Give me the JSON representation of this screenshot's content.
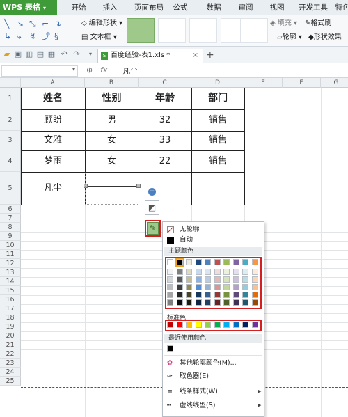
{
  "menu": {
    "app_title": "WPS 表格",
    "tabs": [
      "开始",
      "插入",
      "页面布局",
      "公式",
      "数据",
      "审阅",
      "视图",
      "开发工具",
      "特色"
    ]
  },
  "ribbon": {
    "edit_shape": "编辑形状",
    "text_box": "文本框",
    "fill": "填充",
    "format_brush": "格式刷",
    "outline": "轮廓",
    "shape_effect": "形状效果"
  },
  "toolbar": {
    "doc_tab": "百度经验-表1.xls *",
    "xls_badge": "S",
    "close_label": "×",
    "add_tab": "+"
  },
  "formula_bar": {
    "fx": "fx",
    "value": "凡尘"
  },
  "columns": [
    "A",
    "B",
    "C",
    "D",
    "E",
    "F",
    "G"
  ],
  "rows": [
    "1",
    "2",
    "3",
    "4",
    "5",
    "6",
    "7",
    "8",
    "9",
    "10",
    "11",
    "12",
    "13",
    "14",
    "15",
    "16",
    "17",
    "18",
    "19",
    "20",
    "21",
    "22",
    "23",
    "24",
    "25"
  ],
  "table": {
    "headers": [
      "姓名",
      "性别",
      "年龄",
      "部门"
    ],
    "data": [
      [
        "顾盼",
        "男",
        "32",
        "销售"
      ],
      [
        "文雅",
        "女",
        "33",
        "销售"
      ],
      [
        "梦雨",
        "女",
        "22",
        "销售"
      ],
      [
        "凡尘",
        "",
        "",
        ""
      ]
    ]
  },
  "dropdown": {
    "no_outline": "无轮廓",
    "auto": "自动",
    "theme_colors": "主题颜色",
    "standard_colors": "标准色",
    "recent_colors": "最近使用颜色",
    "more_colors": "其他轮廓颜色(M)...",
    "eyedropper": "取色器(E)",
    "line_style": "线条样式(W)",
    "dash_style": "虚线线型(S)"
  },
  "colors": {
    "theme_top": [
      "#ffffff",
      "#000000",
      "#eeece1",
      "#1f497d",
      "#4f81bd",
      "#c0504d",
      "#9bbb59",
      "#8064a2",
      "#4bacc6",
      "#f79646"
    ],
    "theme_cols": [
      [
        "#f2f2f2",
        "#d8d8d8",
        "#bfbfbf",
        "#a5a5a5",
        "#7f7f7f"
      ],
      [
        "#7f7f7f",
        "#595959",
        "#3f3f3f",
        "#262626",
        "#0c0c0c"
      ],
      [
        "#ddd9c3",
        "#c4bd97",
        "#938953",
        "#494429",
        "#1d1b10"
      ],
      [
        "#c6d9f0",
        "#8db3e2",
        "#548dd4",
        "#17365d",
        "#0f243e"
      ],
      [
        "#dbe5f1",
        "#b8cce4",
        "#95b3d7",
        "#366092",
        "#244061"
      ],
      [
        "#f2dcdb",
        "#e5b9b7",
        "#d99694",
        "#953734",
        "#632423"
      ],
      [
        "#ebf1dd",
        "#d7e3bc",
        "#c3d69b",
        "#76923c",
        "#4f6128"
      ],
      [
        "#e5e0ec",
        "#ccc1d9",
        "#b2a2c7",
        "#5f497a",
        "#3f3151"
      ],
      [
        "#dbeef3",
        "#b7dde8",
        "#92cddc",
        "#31859b",
        "#205867"
      ],
      [
        "#fdeada",
        "#fbd5b5",
        "#fac08f",
        "#e36c09",
        "#974806"
      ]
    ],
    "standard": [
      "#c00000",
      "#ff0000",
      "#ffc000",
      "#ffff00",
      "#92d050",
      "#00b050",
      "#00b0f0",
      "#0070c0",
      "#002060",
      "#7030a0"
    ],
    "recent": [
      "#000000"
    ],
    "accent": "#3f9b38",
    "highlight": "#d42020"
  }
}
